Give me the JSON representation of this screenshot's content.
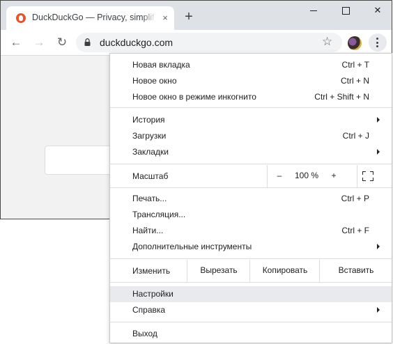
{
  "tab": {
    "title": "DuckDuckGo — Privacy, simplified.",
    "close": "×"
  },
  "titlebar": {
    "new_tab": "+",
    "minimize": "",
    "maximize": "",
    "close": "✕"
  },
  "toolbar": {
    "back": "←",
    "forward": "→",
    "reload": "↻",
    "url": "duckduckgo.com",
    "star": "☆"
  },
  "menu": {
    "group1": [
      {
        "label": "Новая вкладка",
        "shortcut": "Ctrl + T"
      },
      {
        "label": "Новое окно",
        "shortcut": "Ctrl + N"
      },
      {
        "label": "Новое окно в режиме инкогнито",
        "shortcut": "Ctrl + Shift + N"
      }
    ],
    "group2": [
      {
        "label": "История",
        "shortcut": "",
        "submenu": true
      },
      {
        "label": "Загрузки",
        "shortcut": "Ctrl + J"
      },
      {
        "label": "Закладки",
        "shortcut": "",
        "submenu": true
      }
    ],
    "zoom": {
      "label": "Масштаб",
      "minus": "–",
      "value": "100 %",
      "plus": "+"
    },
    "group3": [
      {
        "label": "Печать...",
        "shortcut": "Ctrl + P"
      },
      {
        "label": "Трансляция...",
        "shortcut": ""
      },
      {
        "label": "Найти...",
        "shortcut": "Ctrl + F"
      },
      {
        "label": "Дополнительные инструменты",
        "shortcut": "",
        "submenu": true
      }
    ],
    "edit": {
      "label": "Изменить",
      "cut": "Вырезать",
      "copy": "Копировать",
      "paste": "Вставить"
    },
    "group4": [
      {
        "label": "Настройки",
        "shortcut": "",
        "highlighted": true
      },
      {
        "label": "Справка",
        "shortcut": "",
        "submenu": true
      }
    ],
    "exit": {
      "label": "Выход"
    }
  },
  "colors": {
    "highlight": "#e8eaed",
    "titlebar": "#dee1e6",
    "viewport": "#f2f2f2"
  },
  "icons": [
    "duckduckgo-favicon",
    "lock-icon",
    "star-icon",
    "avatar",
    "kebab-menu-icon",
    "fullscreen-icon",
    "chevron-right-icon"
  ]
}
